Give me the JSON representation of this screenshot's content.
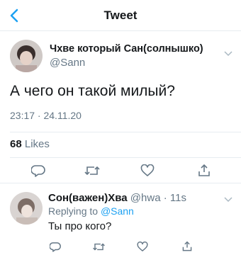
{
  "header": {
    "title": "Tweet"
  },
  "tweet": {
    "author_name": "Чхве который Сан(солнышко)",
    "handle": "@Sann",
    "text": "А чего он такой милый?",
    "timestamp": "23:17 · 24.11.20",
    "likes_count": "68",
    "likes_label": "Likes"
  },
  "reply": {
    "author_name": "Сон(важен)Хва",
    "handle": "@hwa",
    "time": "· 11s",
    "replying_label": "Replying to",
    "replying_handle": "@Sann",
    "text": "Ты про кого?"
  },
  "colors": {
    "accent": "#1da1f2",
    "muted": "#657786",
    "divider": "#e6ecf0"
  },
  "icons": [
    "back-chevron-icon",
    "chevron-down-icon",
    "reply-icon",
    "retweet-icon",
    "like-icon",
    "share-icon"
  ]
}
